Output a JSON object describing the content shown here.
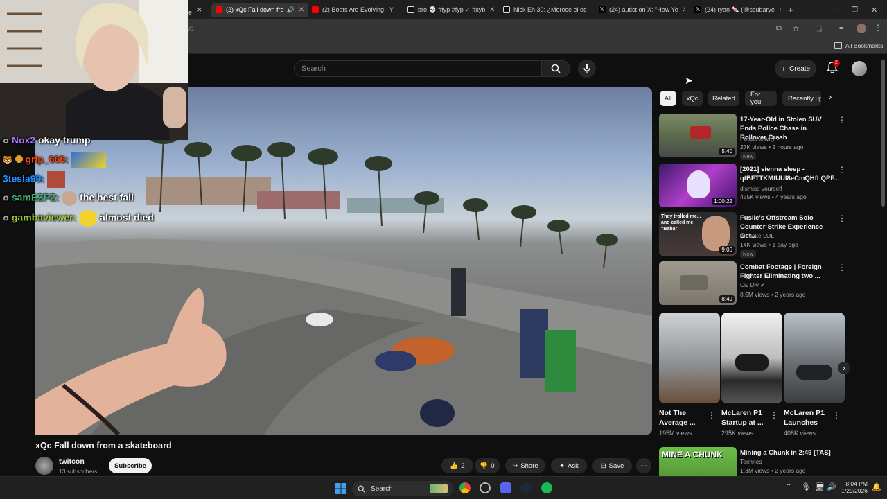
{
  "browser": {
    "tabs": [
      {
        "label": "(2) xQc Fall down fro",
        "active": true
      },
      {
        "label": "(2) Boats Are Evolving - Y",
        "active": false
      },
      {
        "label": "bro 💀 #fyp #fyp ✓ #xyb",
        "active": false
      },
      {
        "label": "Nick Eh 30: ¿Merece el oc",
        "active": false
      },
      {
        "label": "(24) autist on X: \"How Ye",
        "active": false
      },
      {
        "label": "(24) ryan 🍬 (@scubarye",
        "active": false
      }
    ],
    "address_fragment": "/0",
    "bookmarks_label": "All Bookmarks"
  },
  "youtube": {
    "search_placeholder": "Search",
    "create_label": "Create",
    "notification_count": "2",
    "chips": [
      "All",
      "xQc",
      "Related",
      "For you",
      "Recently up"
    ],
    "video": {
      "title": "xQc Fall down from a skateboard",
      "channel": "twitcon",
      "subscribers": "13 subscribers",
      "subscribe_label": "Subscribe",
      "likes": "2",
      "dislikes": "0",
      "share_label": "Share",
      "ask_label": "Ask",
      "save_label": "Save"
    },
    "recommended": [
      {
        "title": "17-Year-Old in Stolen SUV Ends Police Chase in Rollover Crash",
        "channel": "PoliceActivity",
        "verified": true,
        "views": "27K views",
        "age": "2 hours ago",
        "duration": "5:40",
        "badge": "New"
      },
      {
        "title": "[2021] sienna sleep - qtBFTTKMfUUI8eCmQHfLQPF...",
        "channel": "dismiss yourself",
        "verified": false,
        "views": "455K views",
        "age": "4 years ago",
        "duration": "1:00:22",
        "badge": ""
      },
      {
        "title": "Fuslie's Offstream Solo Counter-Strike Experience Get...",
        "channel": "Ah Jake LOL",
        "verified": false,
        "views": "14K views",
        "age": "1 day ago",
        "duration": "9:06",
        "badge": "New",
        "thumb_text": "They trolled me... and called me \"Baba\""
      },
      {
        "title": "Combat Footage | Foreign Fighter Eliminating two ...",
        "channel": "Civ Div",
        "verified": true,
        "views": "8.5M views",
        "age": "2 years ago",
        "duration": "8:49",
        "badge": ""
      }
    ],
    "shorts": [
      {
        "title": "Not The Average ...",
        "views": "195M views"
      },
      {
        "title": "McLaren P1 Startup at ...",
        "views": "295K views"
      },
      {
        "title": "McLaren P1 Launches",
        "views": "408K views"
      }
    ],
    "bottom_rec": {
      "title": "Mining a Chunk in 2:49 [TAS]",
      "channel": "Technes",
      "views": "1.3M views",
      "age": "2 years ago",
      "thumb_text": "MINE A CHUNK"
    }
  },
  "chat": [
    {
      "user": "Nox2",
      "message": "okay trump",
      "color": "#a970ff"
    },
    {
      "user": "grip_666:",
      "message": "",
      "color": "#ff4500"
    },
    {
      "user": "3tesla99:",
      "message": "",
      "color": "#1e90ff"
    },
    {
      "user": "samEZPZ:",
      "message": "the best fall",
      "color": "#3cb371"
    },
    {
      "user": "gambaviewer:",
      "message": "almost died",
      "color": "#9acd32"
    }
  ],
  "taskbar": {
    "search_label": "Search",
    "time": "8:04 PM",
    "date": "1/29/2026"
  }
}
